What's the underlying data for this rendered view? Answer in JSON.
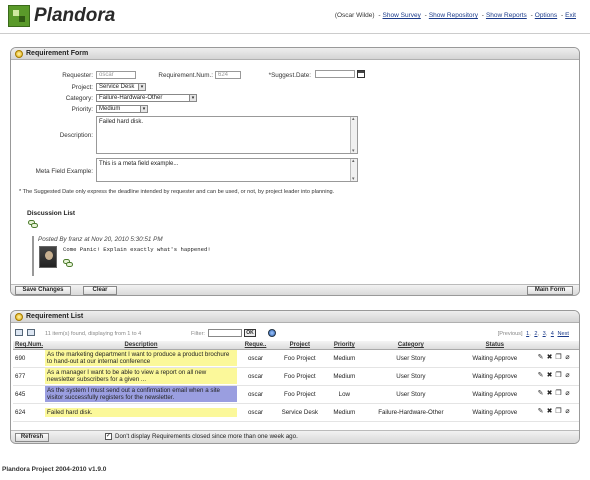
{
  "header": {
    "brand": "Plandora",
    "user_text": "(Oscar Wilde)",
    "links": [
      "Show Survey",
      "Show Repository",
      "Show Reports",
      "Options",
      "Exit"
    ]
  },
  "form": {
    "title": "Requirement Form",
    "requester_label": "Requester:",
    "requester_value": "oscar",
    "reqnum_label": "Requirement.Num.:",
    "reqnum_value": "624",
    "suggest_label": "*Suggest.Date:",
    "project_label": "Project:",
    "project_value": "Service Desk",
    "category_label": "Category:",
    "category_value": "Failure-Hardware-Other",
    "priority_label": "Priority:",
    "priority_value": "Medium",
    "description_label": "Description:",
    "description_value": "Failed hard disk.",
    "meta_label": "Meta Field Example:",
    "meta_value": "This is a meta field example...",
    "note": "* The Suggested Date only express the deadline intended by requester and can be used, or not, by project leader into planning.",
    "discussion_title": "Discussion List",
    "comment_by": "Posted By franz at Nov 20, 2010 5:30:51 PM",
    "comment_text": "Come Panic! Explain exactly what's happened!",
    "buttons": {
      "save": "Save Changes",
      "clear": "Clear",
      "main": "Main Form"
    }
  },
  "list": {
    "title": "Requirement List",
    "found_text": "11 item(s) found, displaying from 1 to 4",
    "filter_label": "Filter:",
    "ok_label": "OK",
    "pager": {
      "prev": "[Previous]",
      "pages": [
        "1",
        "2",
        "3",
        "4"
      ],
      "next": "Next"
    },
    "columns": [
      "Req.Num.",
      "Description",
      "Reque..",
      "Project",
      "Priority",
      "Category",
      "Status"
    ],
    "rows": [
      {
        "num": "690",
        "desc": "As the marketing department I want to produce a product brochure to hand-out at our internal conference",
        "requester": "oscar",
        "project": "Foo Project",
        "priority": "Medium",
        "category": "User Story",
        "status": "Waiting Approve",
        "hl": "yellow"
      },
      {
        "num": "677",
        "desc": "As a manager I want to be able to view a report on all new newsletter subscribers for a given ...",
        "requester": "oscar",
        "project": "Foo Project",
        "priority": "Medium",
        "category": "User Story",
        "status": "Waiting Approve",
        "hl": "yellow"
      },
      {
        "num": "645",
        "desc": "As the system I must send out a confirmation email when a site visitor successfully registers for the newsletter.",
        "requester": "oscar",
        "project": "Foo Project",
        "priority": "Low",
        "category": "User Story",
        "status": "Waiting Approve",
        "hl": "purple"
      },
      {
        "num": "624",
        "desc": "Failed hard disk.",
        "requester": "oscar",
        "project": "Service Desk",
        "priority": "Medium",
        "category": "Failure-Hardware-Other",
        "status": "Waiting Approve",
        "hl": "yellow"
      }
    ],
    "refresh_label": "Refresh",
    "hide_closed_label": "Don't display Requirements closed since more than one week ago."
  },
  "footer": "Plandora Project 2004-2010 v1.9.0",
  "colors": {
    "highlight_yellow": "#fbf89a",
    "highlight_purple": "#9a9ee0",
    "brand_green": "#5a9a2a"
  }
}
